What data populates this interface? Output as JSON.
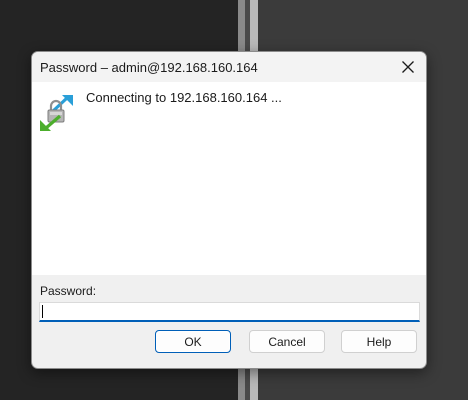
{
  "dialog": {
    "title": "Password – admin@192.168.160.164",
    "status_message": "Connecting to 192.168.160.164 ...",
    "icon": "secure-connection-icon",
    "password_label": "Password:",
    "password_value": "",
    "buttons": {
      "ok": "OK",
      "cancel": "Cancel",
      "help": "Help"
    },
    "close_icon": "close-icon"
  },
  "colors": {
    "accent": "#005fb8",
    "dialog_bg": "#f0f0f0",
    "content_bg": "#ffffff",
    "desktop_bg": "#242424"
  }
}
